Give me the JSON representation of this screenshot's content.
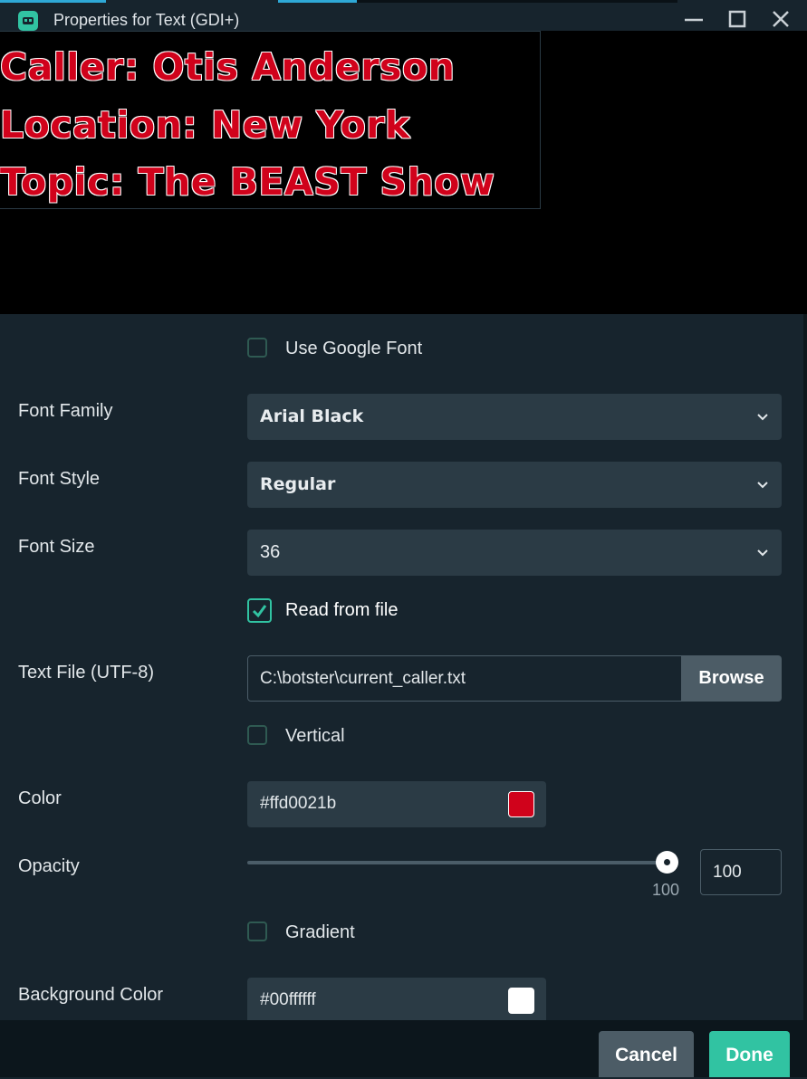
{
  "window": {
    "title": "Properties for Text (GDI+)"
  },
  "preview": {
    "lines": [
      "Caller: Otis Anderson",
      "Location: New York",
      "Topic: The BEAST Show"
    ],
    "text_color": "#d0021b"
  },
  "form": {
    "use_google_font": {
      "label": "Use Google Font",
      "checked": false
    },
    "font_family": {
      "label": "Font Family",
      "value": "Arial Black"
    },
    "font_style": {
      "label": "Font Style",
      "value": "Regular"
    },
    "font_size": {
      "label": "Font Size",
      "value": "36"
    },
    "read_from_file": {
      "label": "Read from file",
      "checked": true
    },
    "text_file": {
      "label": "Text File (UTF-8)",
      "value": "C:\\botster\\current_caller.txt",
      "browse_label": "Browse"
    },
    "vertical": {
      "label": "Vertical",
      "checked": false
    },
    "color": {
      "label": "Color",
      "value": "#ffd0021b",
      "swatch": "#d0021b"
    },
    "opacity": {
      "label": "Opacity",
      "slider_value": "100",
      "input_value": "100",
      "fraction": 1.0
    },
    "gradient": {
      "label": "Gradient",
      "checked": false
    },
    "background_color": {
      "label": "Background Color",
      "value": "#00ffffff",
      "swatch": "#ffffff"
    }
  },
  "footer": {
    "cancel_label": "Cancel",
    "done_label": "Done"
  },
  "colors": {
    "accent": "#31c3a2",
    "panel_bg": "#17242d",
    "field_bg": "#2b3b45"
  }
}
